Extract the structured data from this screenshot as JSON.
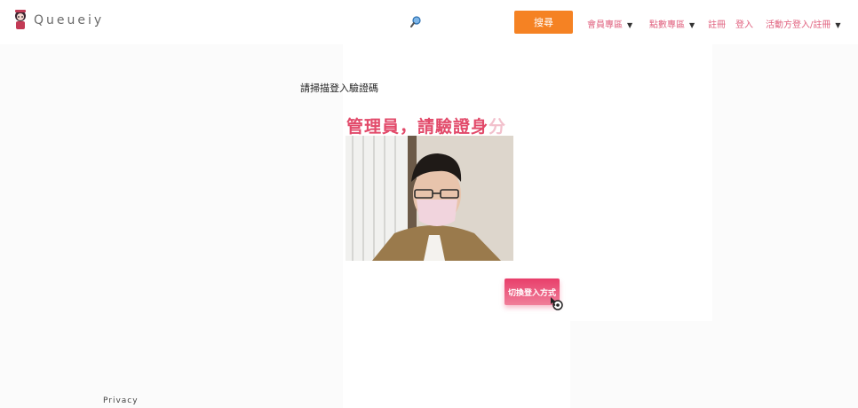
{
  "brand": {
    "name": "Queueiy"
  },
  "navbar": {
    "search_button": "搜尋",
    "items": [
      {
        "label": "會員專區",
        "has_dropdown": true
      },
      {
        "label": "點數專區",
        "has_dropdown": true
      },
      {
        "label": "註冊",
        "has_dropdown": false
      },
      {
        "label": "登入",
        "has_dropdown": false
      },
      {
        "label": "活動方登入/註冊",
        "has_dropdown": true
      }
    ],
    "caret": "▼"
  },
  "main": {
    "prompt": "請掃描登入驗證碼",
    "admin_heading": "管理員，請驗證身",
    "admin_heading_tail": "分",
    "switch_button": "切換登入方式"
  },
  "footer": {
    "link": "Privacy"
  },
  "colors": {
    "accent_orange": "#f58223",
    "accent_pink": "#e24a6a",
    "nav_text": "#e0607e"
  },
  "icons": {
    "search": "magnifier-icon",
    "cursor": "cursor-icon"
  }
}
